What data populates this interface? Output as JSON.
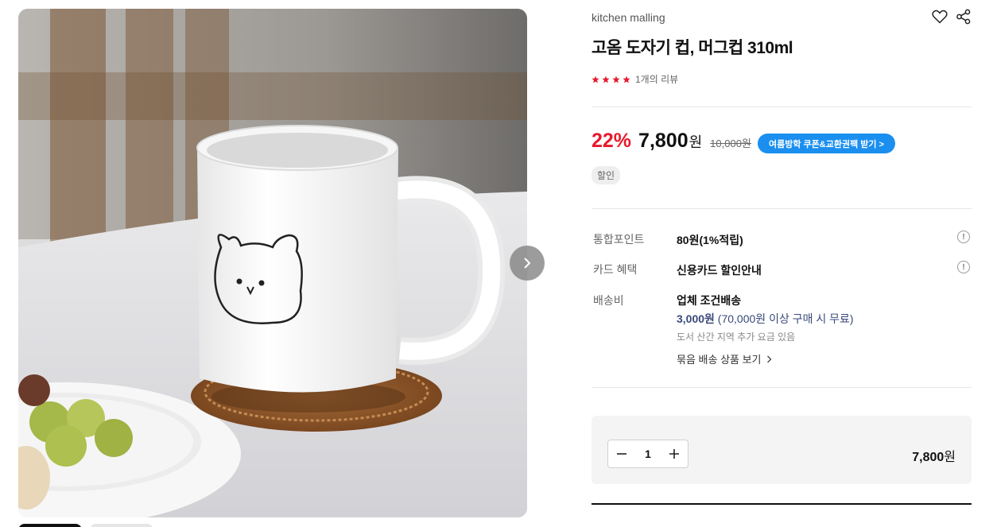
{
  "product": {
    "brand": "kitchen malling",
    "title": "고옴 도자기 컵, 머그컵 310ml",
    "review_count": "1개의 리뷰",
    "rating_stars": 4
  },
  "pricing": {
    "discount": "22%",
    "price": "7,800",
    "currency": "원",
    "original_price": "10,000원",
    "coupon_label": "여름방학 쿠폰&교환권팩 받기 >",
    "sale_tag": "할인"
  },
  "details": {
    "points_label": "통합포인트",
    "points_value": "80원(1%적립)",
    "card_label": "카드 혜택",
    "card_value": "신용카드 할인안내",
    "shipping_label": "배송비",
    "shipping_type": "업체 조건배송",
    "shipping_fee": "3,000원",
    "shipping_condition": " (70,000원 이상 구매 시 무료)",
    "shipping_note": "도서 산간 지역 추가 요금 있음",
    "bundle_link": "묶음 배송 상품 보기",
    "info_icon_glyph": "!"
  },
  "order": {
    "quantity": "1",
    "total_price": "7,800",
    "total_currency": "원"
  },
  "colors": {
    "discount_red": "#e8192c",
    "coupon_blue": "#1a8ff0",
    "star_red": "#e8192c"
  },
  "icons": [
    "heart-icon",
    "share-icon",
    "chevron-right-icon",
    "minus-icon",
    "plus-icon",
    "star-icon",
    "info-icon"
  ]
}
